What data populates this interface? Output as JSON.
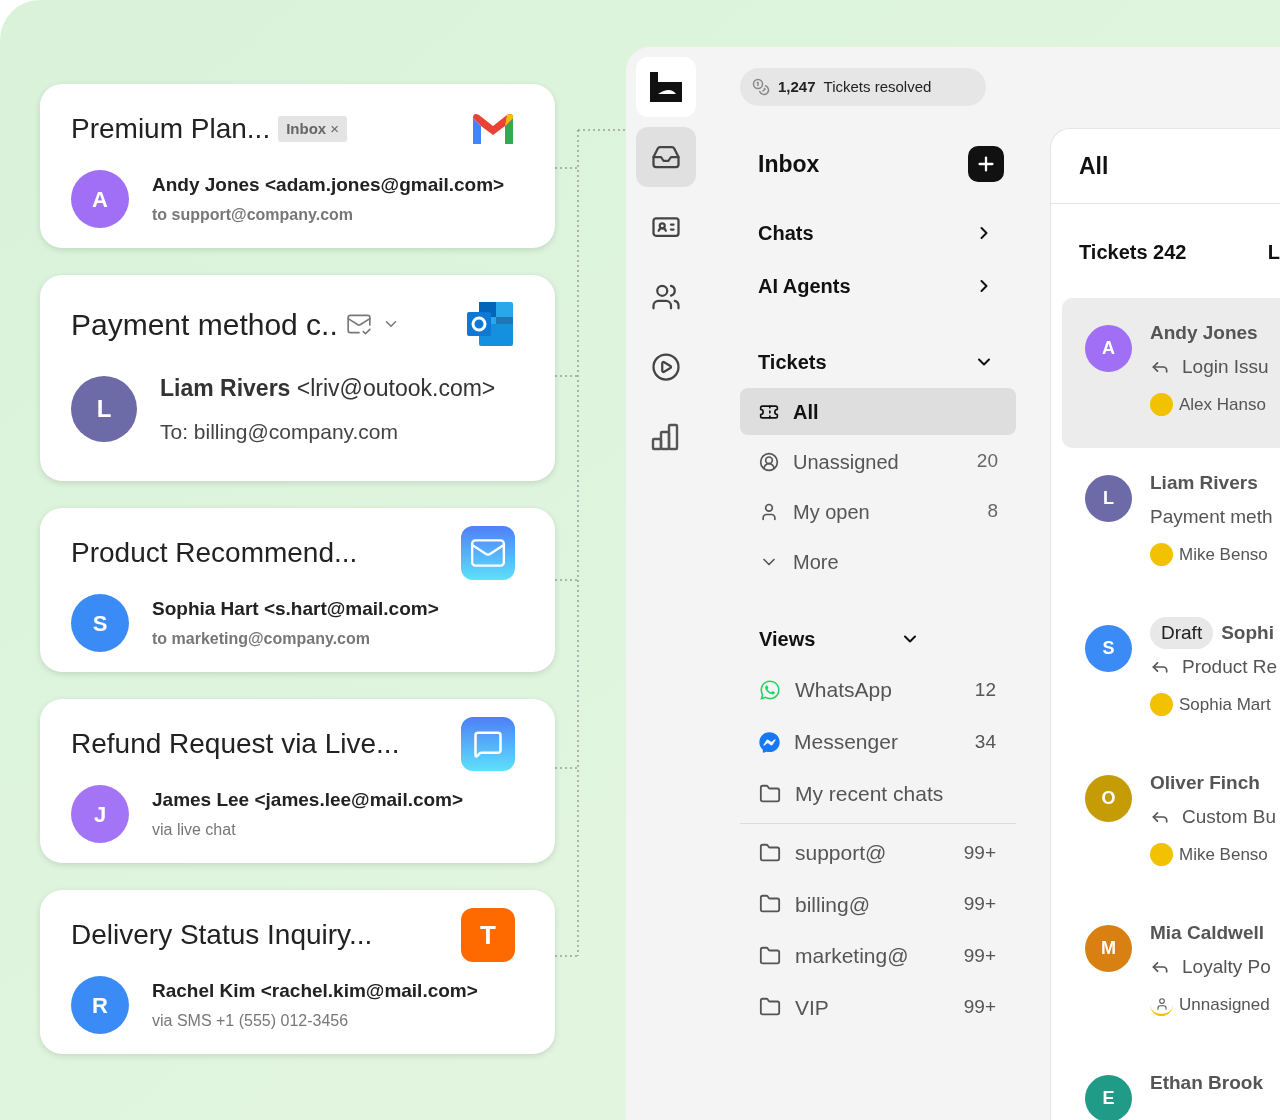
{
  "cards": [
    {
      "title": "Premium Plan...",
      "tag": {
        "label": "Inbox",
        "close": "×"
      },
      "kind": "gmail",
      "avatar": "A",
      "color": "#a06ff6",
      "sender": "Andy Jones <adam.jones@gmail.com>",
      "recipient": "to support@company.com"
    },
    {
      "title": "Payment method c..",
      "status_icon": true,
      "kind": "outlook",
      "avatar": "L",
      "color": "#6d6aa8",
      "sender": "**Liam Rivers** <lriv@outook.com>",
      "recipient": "To:  billing@company.com"
    },
    {
      "title": "Product Recommend...",
      "kind": "mail",
      "avatar": "S",
      "color": "#3b8bf6",
      "sender": "Sophia Hart <s.hart@mail.com>",
      "recipient": "to marketing@company.com"
    },
    {
      "title": "Refund Request via Live...",
      "kind": "chat",
      "avatar": "J",
      "color": "#a374f5",
      "sender": "James Lee <james.lee@mail.com>",
      "recipient": "via live chat"
    },
    {
      "title": "Delivery Status Inquiry...",
      "kind": "letter",
      "source_letter": "T",
      "avatar": "R",
      "color": "#3b8bf6",
      "sender": "Rachel Kim <rachel.kim@mail.com>",
      "recipient": "via SMS +1 (555) 012-3456"
    }
  ],
  "rail": [
    {
      "kind": "logo",
      "selected": false
    },
    {
      "kind": "inbox",
      "selected": true
    },
    {
      "kind": "contact",
      "selected": false
    },
    {
      "kind": "team",
      "selected": false
    },
    {
      "kind": "play",
      "selected": false
    },
    {
      "kind": "chart",
      "selected": false
    }
  ],
  "stats": {
    "value": "1,247",
    "label": "Tickets resolved"
  },
  "nav": {
    "title": "Inbox",
    "sections": [
      {
        "label": "Chats",
        "expanded": false
      },
      {
        "label": "AI Agents",
        "expanded": false
      },
      {
        "label": "Tickets",
        "expanded": true
      }
    ],
    "ticket_items": [
      {
        "label": "All",
        "selected": true
      },
      {
        "label": "Unassigned",
        "count": "20",
        "selected": false
      },
      {
        "label": "My open",
        "count": "8",
        "selected": false
      },
      {
        "label": "More",
        "selected": false
      }
    ],
    "views_title": "Views",
    "views_expanded": true,
    "views": [
      {
        "label": "WhatsApp",
        "kind": "whatsapp",
        "count": "12"
      },
      {
        "label": "Messenger",
        "kind": "messenger",
        "count": "34"
      },
      {
        "label": "My recent chats",
        "kind": "folder"
      }
    ],
    "folders": [
      {
        "label": "support@",
        "count": "99+"
      },
      {
        "label": "billing@",
        "count": "99+"
      },
      {
        "label": "marketing@",
        "count": "99+"
      },
      {
        "label": "VIP",
        "count": "99+"
      }
    ]
  },
  "tickets": {
    "title": "All",
    "count_label": "Tickets 242",
    "column_2": "L",
    "rows": [
      {
        "avatar": "A",
        "color": "#a06ff6",
        "name": "Andy Jones",
        "reply": true,
        "subject": "Login Issu",
        "assignee": "Alex Hanso",
        "assigned": true,
        "selected": true
      },
      {
        "avatar": "L",
        "color": "#6d6aa8",
        "name": "Liam Rivers",
        "reply": false,
        "subject": "Payment meth",
        "assignee": "Mike Benso",
        "assigned": true,
        "selected": false
      },
      {
        "avatar": "S",
        "color": "#3b8bf6",
        "draft": "Draft",
        "name": "Sophi",
        "reply": true,
        "subject": "Product Re",
        "assignee": "Sophia Mart",
        "assigned": true,
        "selected": false
      },
      {
        "avatar": "O",
        "color": "#c59b06",
        "name": "Oliver Finch",
        "reply": true,
        "subject": "Custom Bu",
        "assignee": "Mike Benso",
        "assigned": true,
        "selected": false
      },
      {
        "avatar": "M",
        "color": "#d98012",
        "name": "Mia Caldwell",
        "reply": true,
        "subject": "Loyalty Po",
        "assignee": "Unnasigned",
        "assigned": false,
        "selected": false
      },
      {
        "avatar": "E",
        "color": "#1f9b87",
        "name": "Ethan Brook",
        "selected": false
      }
    ]
  }
}
